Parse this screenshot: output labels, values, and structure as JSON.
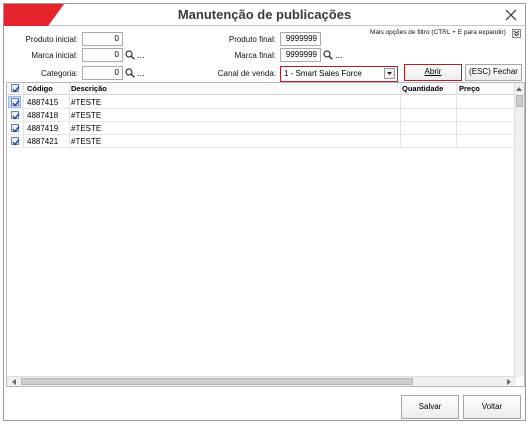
{
  "window": {
    "title": "Manutenção de publicações",
    "brand_color": "#e4232b"
  },
  "filters": {
    "produto_inicial_label": "Produto inicial:",
    "produto_inicial_value": "0",
    "marca_inicial_label": "Marca inicial:",
    "marca_inicial_value": "0",
    "categoria_label": "Categoria:",
    "categoria_value": "0",
    "produto_final_label": "Produto final:",
    "produto_final_value": "9999999",
    "marca_final_label": "Marca final:",
    "marca_final_value": "9999999",
    "canal_label": "Canal de venda:",
    "canal_value": "1 - Smart Sales Force",
    "more_options": "Mais opções de filtro (CTRL + E para expandir)",
    "lookup_dots": "...",
    "abrir_label": "Abrir",
    "fechar_label": "(ESC) Fechar"
  },
  "grid": {
    "columns": [
      "Código",
      "Descrição",
      "Quantidade",
      "Preço"
    ],
    "rows": [
      {
        "codigo": "4887415",
        "descricao": "#TESTE",
        "checked": true
      },
      {
        "codigo": "4887418",
        "descricao": "#TESTE",
        "checked": true
      },
      {
        "codigo": "4887419",
        "descricao": "#TESTE",
        "checked": true
      },
      {
        "codigo": "4887421",
        "descricao": "#TESTE",
        "checked": true
      }
    ]
  },
  "footer": {
    "salvar_label": "Salvar",
    "voltar_label": "Voltar"
  }
}
